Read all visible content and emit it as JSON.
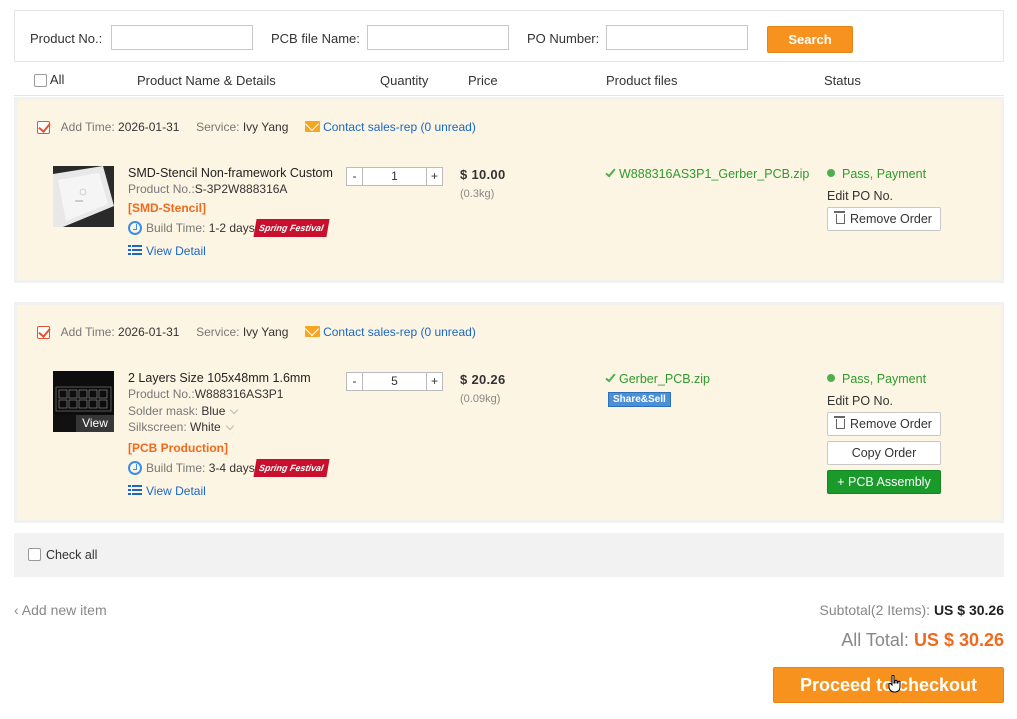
{
  "search": {
    "product_no_label": "Product No.:",
    "product_no_value": "",
    "pcb_file_label": "PCB file Name:",
    "pcb_file_value": "",
    "po_label": "PO Number:",
    "po_value": "",
    "search_button": "Search"
  },
  "columns": {
    "all": "All",
    "product": "Product Name & Details",
    "quantity": "Quantity",
    "price": "Price",
    "files": "Product files",
    "status": "Status"
  },
  "orders": [
    {
      "checked": true,
      "add_time_label": "Add Time:",
      "add_time": "2026-01-31",
      "service_label": "Service:",
      "service": "Ivy Yang",
      "contact": "Contact sales-rep (0 unread)",
      "name": "SMD-Stencil Non-framework Custom",
      "product_no_label": "Product No.:",
      "product_no": "S-3P2W888316A",
      "category": "[SMD-Stencil]",
      "build_label": "Build Time:",
      "build_time": "1-2 days",
      "festival": "Spring Festival",
      "view_detail": "View Detail",
      "quantity": "1",
      "price": "$ 10.00",
      "weight": "(0.3kg)",
      "file": "W888316AS3P1_Gerber_PCB.zip",
      "status": "Pass, Payment",
      "edit_po": "Edit PO No.",
      "remove": "Remove Order"
    },
    {
      "checked": true,
      "add_time_label": "Add Time:",
      "add_time": "2026-01-31",
      "service_label": "Service:",
      "service": "Ivy Yang",
      "contact": "Contact sales-rep (0 unread)",
      "name": "2 Layers Size 105x48mm 1.6mm",
      "product_no_label": "Product No.:",
      "product_no": "W888316AS3P1",
      "solder_label": "Solder mask:",
      "solder": "Blue",
      "silk_label": "Silkscreen:",
      "silk": "White",
      "category": "[PCB Production]",
      "build_label": "Build Time:",
      "build_time": "3-4 days",
      "festival": "Spring Festival",
      "view_detail": "View Detail",
      "thumb_view": "View",
      "quantity": "5",
      "price": "$ 20.26",
      "weight": "(0.09kg)",
      "file": "Gerber_PCB.zip",
      "share": "Share&Sell",
      "status": "Pass, Payment",
      "edit_po": "Edit PO No.",
      "remove": "Remove Order",
      "copy": "Copy Order",
      "assembly": "+ PCB Assembly"
    }
  ],
  "footer": {
    "check_all": "Check all",
    "add_new": "Add new item",
    "subtotal_label": "Subtotal(2 Items):",
    "subtotal": "US $ 30.26",
    "all_total_label": "All Total:",
    "all_total": "US $ 30.26",
    "checkout": "Proceed to checkout"
  },
  "colors": {
    "accent_orange": "#f7921e",
    "order_bg": "#fdf5e3",
    "link_blue": "#1a67c4",
    "status_green": "#2e9a2e",
    "assembly_green": "#1b9a2c"
  }
}
